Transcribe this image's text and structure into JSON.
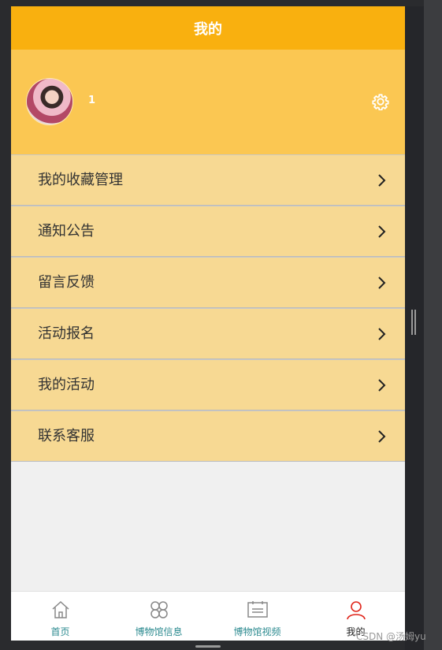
{
  "header": {
    "title": "我的"
  },
  "profile": {
    "username": "1"
  },
  "menu": [
    {
      "label": "我的收藏管理"
    },
    {
      "label": "通知公告"
    },
    {
      "label": "留言反馈"
    },
    {
      "label": "活动报名"
    },
    {
      "label": "我的活动"
    },
    {
      "label": "联系客服"
    }
  ],
  "tabs": [
    {
      "label": "首页",
      "icon": "home-icon"
    },
    {
      "label": "博物馆信息",
      "icon": "grid-icon"
    },
    {
      "label": "博物馆视频",
      "icon": "video-icon"
    },
    {
      "label": "我的",
      "icon": "user-icon",
      "active": true
    }
  ],
  "colors": {
    "accent": "#f9b00f",
    "profile_bg": "#fbc752",
    "menu_bg": "#f7d993",
    "tab_text": "#2b8a8f",
    "active_icon": "#e0261b"
  },
  "watermark": "CSDN @汤姆yu"
}
